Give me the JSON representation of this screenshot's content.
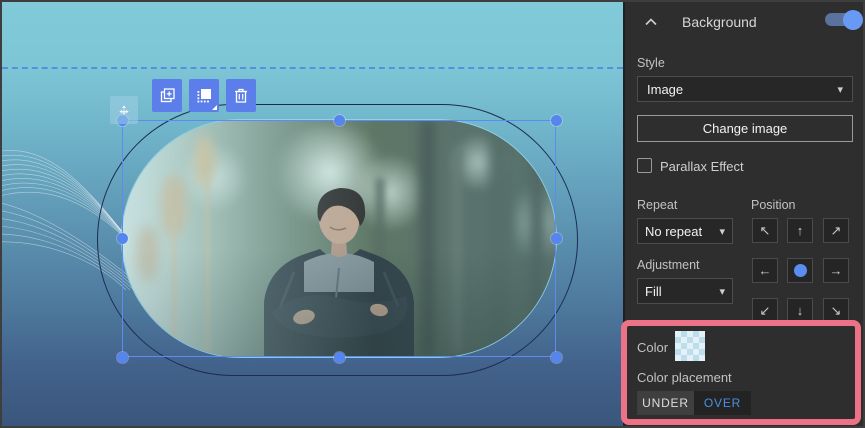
{
  "colors": {
    "accent_blue": "#5b7eea",
    "selection_blue": "#5c8cf2",
    "panel_bg": "#2e2e2e",
    "link_blue": "#4a90e2",
    "highlight_pink": "#ee7287",
    "toggle_knob": "#699af3",
    "canvas_top": "#81cad9",
    "canvas_bottom": "#3a567b"
  },
  "canvas": {
    "toolbar": {
      "duplicate_icon": "duplicate-icon",
      "change_design_icon": "change-design-icon",
      "delete_icon": "trash-icon"
    },
    "move_icon": "move-icon",
    "selection": {
      "shape": "pill-image"
    },
    "decoration": "wave-mesh"
  },
  "panel": {
    "title": "Background",
    "collapse_icon": "chevron-up-icon",
    "toggle_on": true,
    "style": {
      "label": "Style",
      "value": "Image"
    },
    "change_image": "Change image",
    "parallax": "Parallax Effect",
    "parallax_checked": false,
    "repeat": {
      "label": "Repeat",
      "value": "No repeat"
    },
    "position": {
      "label": "Position",
      "cells": [
        "↖",
        "↑",
        "↗",
        "←",
        "",
        "→",
        "↙",
        "↓",
        "↘"
      ],
      "selected": "center"
    },
    "adjustment": {
      "label": "Adjustment",
      "value": "Fill"
    },
    "color": {
      "label": "Color",
      "value": "transparent-checker"
    },
    "color_placement": {
      "label": "Color placement",
      "options": {
        "under": "UNDER",
        "over": "OVER"
      },
      "selected": "UNDER"
    }
  }
}
